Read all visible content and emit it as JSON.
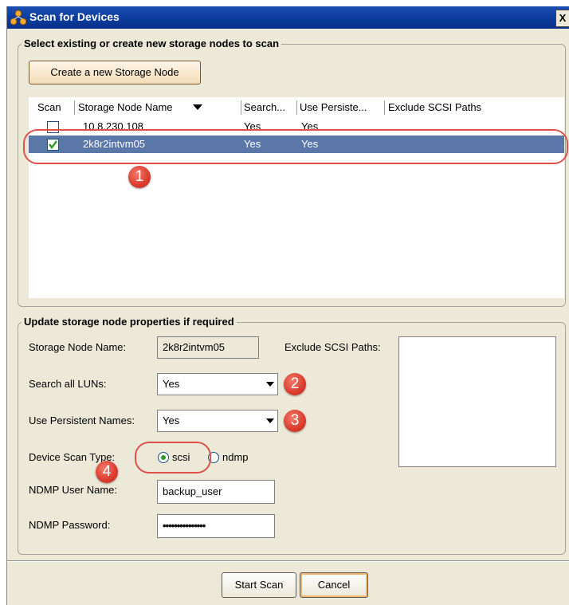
{
  "window": {
    "title": "Scan for Devices",
    "close_label": "X"
  },
  "nodes_group": {
    "title": "Select existing or create new storage nodes to scan",
    "create_button": "Create a new Storage Node",
    "columns": [
      "Scan",
      "Storage Node Name",
      "Search...",
      "Use Persiste...",
      "Exclude SCSI Paths"
    ],
    "sort_indicator": "chevron-down-icon",
    "rows": [
      {
        "checked": false,
        "name": "10.8.230.108",
        "search": "Yes",
        "persistent": "Yes",
        "exclude": ""
      },
      {
        "checked": true,
        "name": "2k8r2intvm05",
        "search": "Yes",
        "persistent": "Yes",
        "exclude": "",
        "selected": true
      }
    ]
  },
  "props_group": {
    "title": "Update storage node properties if required",
    "storage_node_label": "Storage Node Name:",
    "storage_node_value": "2k8r2intvm05",
    "exclude_label": "Exclude SCSI Paths:",
    "search_luns_label": "Search all LUNs:",
    "search_luns_value": "Yes",
    "persistent_label": "Use Persistent Names:",
    "persistent_value": "Yes",
    "scan_type_label": "Device Scan Type:",
    "scan_type_options": [
      "scsi",
      "ndmp"
    ],
    "scan_type_selected": "scsi",
    "ndmp_user_label": "NDMP User Name:",
    "ndmp_user_value": "backup_user",
    "ndmp_password_label": "NDMP Password:",
    "ndmp_password_value": "•••••••••••••••"
  },
  "footer": {
    "start_button": "Start Scan",
    "cancel_button": "Cancel"
  },
  "annotations": {
    "badges": [
      "1",
      "2",
      "3",
      "4"
    ],
    "badge_color": "#d93c2e",
    "highlight_color": "#e0504a"
  },
  "colors": {
    "titlebar": "#0a3a9a",
    "dialog_bg": "#ece9d8",
    "selected_row": "#5a77a8",
    "radio_dot": "#2a9a2a"
  }
}
